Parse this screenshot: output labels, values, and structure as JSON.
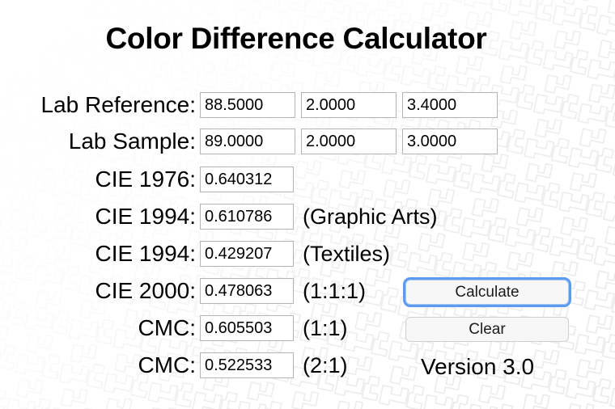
{
  "app": {
    "title": "Color Difference Calculator",
    "version_label": "Version 3.0",
    "accent_focus_color": "#5b9bf0",
    "field_border_color": "#b4b4b4",
    "background_color": "#ffffff",
    "watermark_color": "#e9e9e9"
  },
  "inputs": {
    "reference": {
      "label": "Lab Reference:",
      "L": "88.5000",
      "a": "2.0000",
      "b": "3.4000",
      "placeholder_L": "L",
      "placeholder_a": "a",
      "placeholder_b": "b"
    },
    "sample": {
      "label": "Lab Sample:",
      "L": "89.0000",
      "a": "2.0000",
      "b": "3.0000",
      "placeholder_L": "L",
      "placeholder_a": "a",
      "placeholder_b": "b"
    }
  },
  "results": [
    {
      "label": "CIE 1976:",
      "value": "0.640312",
      "note": ""
    },
    {
      "label": "CIE 1994:",
      "value": "0.610786",
      "note": "(Graphic Arts)"
    },
    {
      "label": "CIE 1994:",
      "value": "0.429207",
      "note": "(Textiles)"
    },
    {
      "label": "CIE 2000:",
      "value": "0.478063",
      "note": "(1:1:1)"
    },
    {
      "label": "CMC:",
      "value": "0.605503",
      "note": "(1:1)"
    },
    {
      "label": "CMC:",
      "value": "0.522533",
      "note": "(2:1)"
    }
  ],
  "buttons": {
    "calculate": "Calculate",
    "clear": "Clear"
  }
}
